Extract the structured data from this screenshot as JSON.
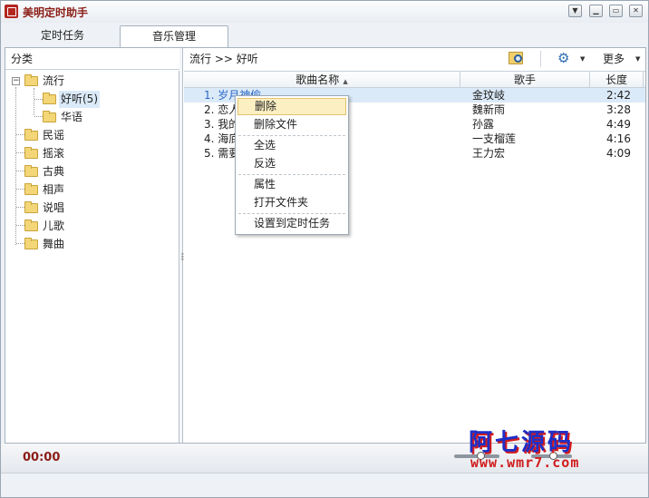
{
  "window": {
    "title": "美明定时助手"
  },
  "tabs": [
    {
      "label": "定时任务",
      "active": false
    },
    {
      "label": "音乐管理",
      "active": true
    }
  ],
  "category": {
    "header": "分类",
    "tree": [
      {
        "label": "流行",
        "expanded": true,
        "children": [
          {
            "label": "好听(5)",
            "selected": true
          },
          {
            "label": "华语"
          }
        ]
      },
      {
        "label": "民谣"
      },
      {
        "label": "摇滚"
      },
      {
        "label": "古典"
      },
      {
        "label": "相声"
      },
      {
        "label": "说唱"
      },
      {
        "label": "儿歌"
      },
      {
        "label": "舞曲"
      }
    ]
  },
  "breadcrumb": "流行 >> 好听",
  "toolbar": {
    "more_label": "更多"
  },
  "columns": {
    "title": "歌曲名称",
    "singer": "歌手",
    "length": "长度"
  },
  "songs": [
    {
      "title": "1. 岁月神偷",
      "singer": "金玟岐",
      "length": "2:42",
      "selected": true
    },
    {
      "title": "2. 恋人心",
      "singer": "魏新雨",
      "length": "3:28"
    },
    {
      "title": "3. 我的",
      "singer": "孙露",
      "length": "4:49"
    },
    {
      "title": "4. 海底",
      "singer": "一支榴莲",
      "length": "4:16"
    },
    {
      "title": "5. 需要人陪",
      "singer": "王力宏",
      "length": "4:09"
    }
  ],
  "context_menu": [
    {
      "label": "删除",
      "highlighted": true
    },
    {
      "label": "删除文件"
    },
    {
      "label": "全选"
    },
    {
      "label": "反选"
    },
    {
      "label": "属性"
    },
    {
      "label": "打开文件夹"
    },
    {
      "label": "设置到定时任务"
    }
  ],
  "status": {
    "time": "00:00"
  },
  "watermark": {
    "top": "阿七源码",
    "bottom": "www.wmr7.com"
  },
  "colors": {
    "accent": "#8a1d17",
    "selection": "#dbeaf8",
    "menu_hot": "#fcefc2"
  },
  "icons": {
    "search_folder": "search-folder-icon",
    "settings": "gear-icon"
  }
}
